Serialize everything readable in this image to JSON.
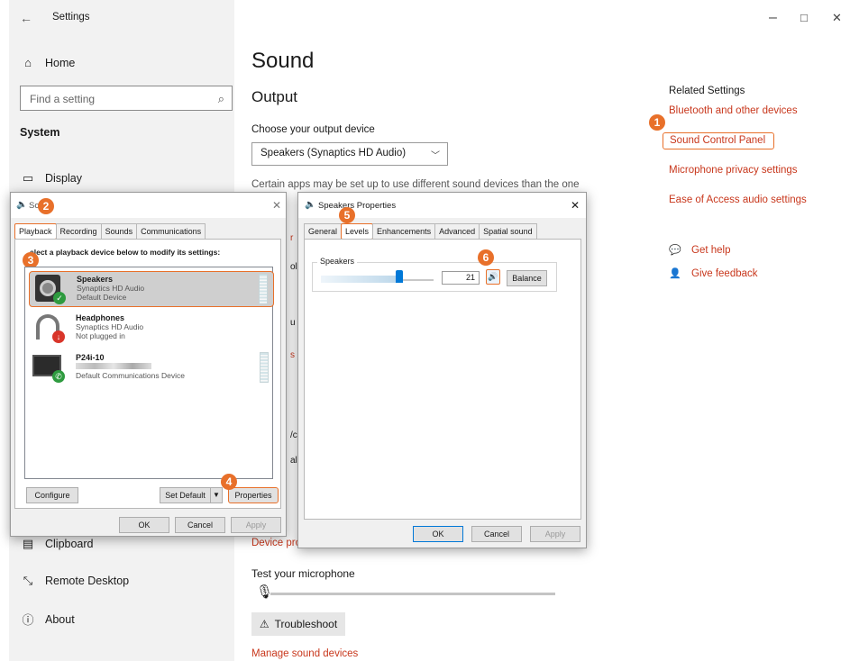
{
  "window": {
    "title": "Settings",
    "minimize": "–",
    "maximize": "□",
    "close": "✕"
  },
  "sidebar": {
    "home": "Home",
    "search_placeholder": "Find a setting",
    "section": "System",
    "items": [
      "Display",
      "Clipboard",
      "Remote Desktop",
      "About"
    ]
  },
  "main": {
    "title": "Sound",
    "output_heading": "Output",
    "choose_output": "Choose your output device",
    "output_device": "Speakers (Synaptics HD Audio)",
    "apps_note": "Certain apps may be set up to use different sound devices than the one",
    "device_properties": "Device pro",
    "test_mic": "Test your microphone",
    "troubleshoot": "Troubleshoot",
    "manage_devices": "Manage sound devices"
  },
  "related": {
    "heading": "Related Settings",
    "links": [
      "Bluetooth and other devices",
      "Sound Control Panel",
      "Microphone privacy settings",
      "Ease of Access audio settings"
    ],
    "get_help": "Get help",
    "give_feedback": "Give feedback"
  },
  "sound_dialog": {
    "title": "So",
    "tabs": [
      "Playback",
      "Recording",
      "Sounds",
      "Communications"
    ],
    "instruction": "elect a playback device below to modify its settings:",
    "devices": [
      {
        "name": "Speakers",
        "driver": "Synaptics HD Audio",
        "status": "Default Device"
      },
      {
        "name": "Headphones",
        "driver": "Synaptics HD Audio",
        "status": "Not plugged in"
      },
      {
        "name": "P24i-10",
        "driver": "",
        "status": "Default Communications Device"
      }
    ],
    "configure": "Configure",
    "set_default": "Set Default",
    "properties": "Properties",
    "ok": "OK",
    "cancel": "Cancel",
    "apply": "Apply"
  },
  "props_dialog": {
    "title": "Speakers Properties",
    "tabs": [
      "General",
      "Levels",
      "Enhancements",
      "Advanced",
      "Spatial sound"
    ],
    "group_label": "Speakers",
    "level_value": "21",
    "level_fraction": 0.21,
    "balance": "Balance",
    "ok": "OK",
    "cancel": "Cancel",
    "apply": "Apply"
  },
  "badges": [
    "1",
    "2",
    "3",
    "4",
    "5",
    "6"
  ],
  "colors": {
    "accent_red": "#c8371c",
    "highlight_orange": "#e8702a",
    "selection_blue": "#0078d7"
  },
  "icons": [
    "back-arrow-icon",
    "home-icon",
    "search-icon",
    "display-icon",
    "clipboard-icon",
    "remote-desktop-icon",
    "about-icon",
    "get-help-icon",
    "feedback-icon",
    "microphone-icon",
    "warning-icon",
    "speaker-volume-icon"
  ]
}
